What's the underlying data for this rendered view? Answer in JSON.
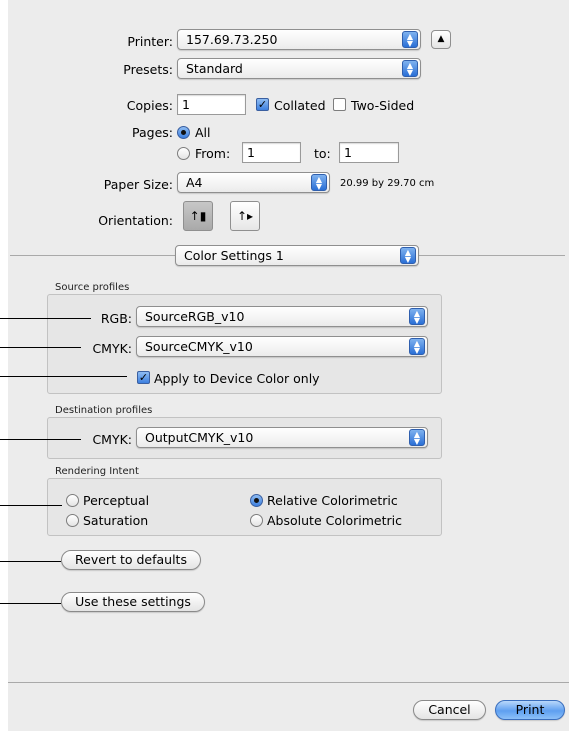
{
  "printer": {
    "label": "Printer:",
    "value": "157.69.73.250",
    "disclosure_icon": "triangle-up-icon"
  },
  "presets": {
    "label": "Presets:",
    "value": "Standard"
  },
  "copies": {
    "label": "Copies:",
    "value": "1",
    "collated_label": "Collated",
    "collated_checked": true,
    "two_sided_label": "Two-Sided",
    "two_sided_checked": false
  },
  "pages": {
    "label": "Pages:",
    "all_label": "All",
    "from_label": "From:",
    "from_value": "1",
    "to_label": "to:",
    "to_value": "1",
    "selected": "All"
  },
  "paper": {
    "label": "Paper Size:",
    "value": "A4",
    "size_text": "20.99 by 29.70 cm"
  },
  "orientation": {
    "label": "Orientation:",
    "selected": "portrait",
    "icons": [
      "portrait-icon",
      "landscape-icon"
    ]
  },
  "panel_select": {
    "value": "Color Settings 1"
  },
  "source_profiles": {
    "title": "Source profiles",
    "rgb_label": "RGB:",
    "rgb_value": "SourceRGB_v10",
    "cmyk_label": "CMYK:",
    "cmyk_value": "SourceCMYK_v10",
    "apply_label": "Apply to Device Color only",
    "apply_checked": true
  },
  "destination_profiles": {
    "title": "Destination profiles",
    "cmyk_label": "CMYK:",
    "cmyk_value": "OutputCMYK_v10"
  },
  "rendering_intent": {
    "title": "Rendering Intent",
    "options": [
      "Perceptual",
      "Saturation",
      "Relative Colorimetric",
      "Absolute Colorimetric"
    ],
    "selected": "Relative Colorimetric"
  },
  "buttons": {
    "revert": "Revert to defaults",
    "use": "Use these settings",
    "cancel": "Cancel",
    "print": "Print"
  },
  "colors": {
    "accent": "#3c7fdf",
    "panel_bg": "#ececec"
  }
}
